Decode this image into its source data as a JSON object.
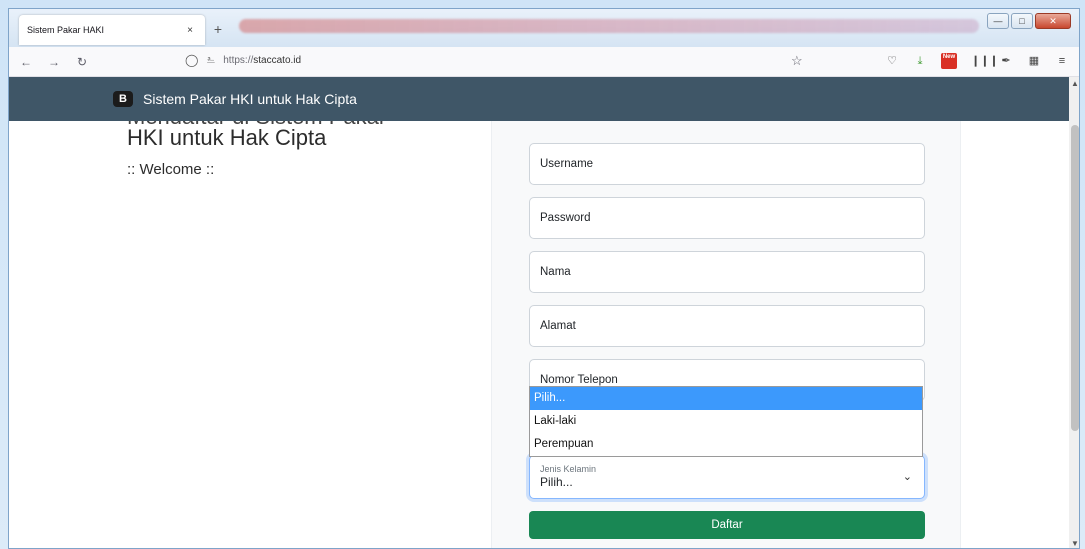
{
  "browser": {
    "tab_title": "Sistem Pakar HAKI",
    "tab_close": "×",
    "new_tab": "+",
    "url_scheme": "https://",
    "url_host": "staccato.id",
    "ext_new_label": "New"
  },
  "site": {
    "brand_icon_letter": "B",
    "brand_text": "Sistem Pakar HKI untuk Hak Cipta"
  },
  "hero": {
    "partial_line": "Mendaftar di Sistem Pakar",
    "title": "HKI untuk Hak Cipta",
    "welcome": ":: Welcome ::"
  },
  "form": {
    "fields": [
      {
        "placeholder": "Username"
      },
      {
        "placeholder": "Password"
      },
      {
        "placeholder": "Nama"
      },
      {
        "placeholder": "Alamat"
      },
      {
        "placeholder": "Nomor Telepon"
      }
    ],
    "gender": {
      "label": "Jenis Kelamin",
      "value": "Pilih...",
      "options": [
        "Pilih...",
        "Laki-laki",
        "Perempuan"
      ],
      "selected_index": 0
    },
    "submit_label": "Daftar"
  },
  "colors": {
    "header_bg": "#3f5667",
    "submit_bg": "#198754",
    "option_highlight": "#3c99fc"
  }
}
